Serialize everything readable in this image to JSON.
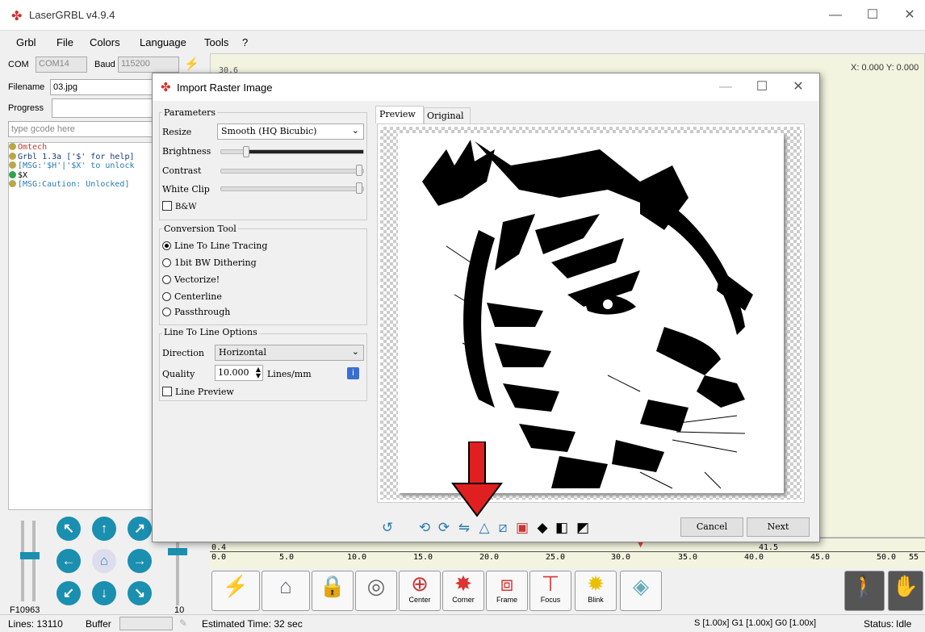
{
  "window": {
    "title": "LaserGRBL v4.9.4",
    "controls": {
      "minimize": "—",
      "maximize": "☐",
      "close": "✕"
    }
  },
  "menu": [
    "Grbl",
    "File",
    "Colors",
    "Language",
    "Tools",
    "?"
  ],
  "left_panel": {
    "com_label": "COM",
    "com_value": "COM14",
    "baud_label": "Baud",
    "baud_value": "115200",
    "filename_label": "Filename",
    "filename_value": "03.jpg",
    "progress_label": "Progress",
    "gcode_placeholder": "type gcode here",
    "console_lines": [
      {
        "text": "Omtech",
        "icon": "info",
        "color": "#c0392b"
      },
      {
        "text": "Grbl 1.3a ['$' for help]",
        "icon": "info",
        "color": "#1a3a7a"
      },
      {
        "text": "[MSG:'$H'|'$X' to unlock",
        "icon": "info",
        "color": "#2a7ab0"
      },
      {
        "text": "$X",
        "icon": "ok",
        "color": "#000"
      },
      {
        "text": "[MSG:Caution: Unlocked]",
        "icon": "info",
        "color": "#2a7ab0"
      }
    ],
    "speed_label": "F10963",
    "power_label": "10"
  },
  "canvas": {
    "coords": "X: 0.000 Y: 0.000",
    "top_tick": "30.6",
    "ruler_ticks": [
      "0.0",
      "5.0",
      "10.0",
      "15.0",
      "20.0",
      "25.0",
      "30.0",
      "35.0",
      "40.0",
      "45.0",
      "50.0",
      "55"
    ],
    "ruler_mark": "41.5",
    "ruler_left": "0.4"
  },
  "toolbar": {
    "labels": [
      "Center",
      "Corner",
      "Frame",
      "Focus",
      "Blink"
    ]
  },
  "status": {
    "lines": "Lines: 13110",
    "buffer": "Buffer",
    "estimated": "Estimated Time:  32 sec",
    "overrides": "S [1.00x] G1 [1.00x] G0 [1.00x]",
    "status_label": "Status:",
    "status_value": "Idle"
  },
  "dialog": {
    "title": "Import Raster Image",
    "parameters_title": "Parameters",
    "resize_label": "Resize",
    "resize_value": "Smooth (HQ Bicubic)",
    "brightness_label": "Brightness",
    "contrast_label": "Contrast",
    "whiteclip_label": "White Clip",
    "bw_label": "B&W",
    "brightness_fraction": 0.18,
    "contrast_fraction": 1.0,
    "whiteclip_fraction": 1.0,
    "conversion_title": "Conversion Tool",
    "conversion_options": [
      "Line To Line Tracing",
      "1bit BW Dithering",
      "Vectorize!",
      "Centerline",
      "Passthrough"
    ],
    "conversion_selected": 0,
    "ltl_title": "Line To Line Options",
    "direction_label": "Direction",
    "direction_value": "Horizontal",
    "quality_label": "Quality",
    "quality_value": "10.000",
    "quality_unit": "Lines/mm",
    "line_preview_label": "Line Preview",
    "tabs": [
      "Preview",
      "Original"
    ],
    "cancel": "Cancel",
    "next": "Next"
  },
  "colors": {
    "accent": "#1a8fb0",
    "arrow": "#e02020",
    "canvas_bg": "#f2f4df"
  }
}
